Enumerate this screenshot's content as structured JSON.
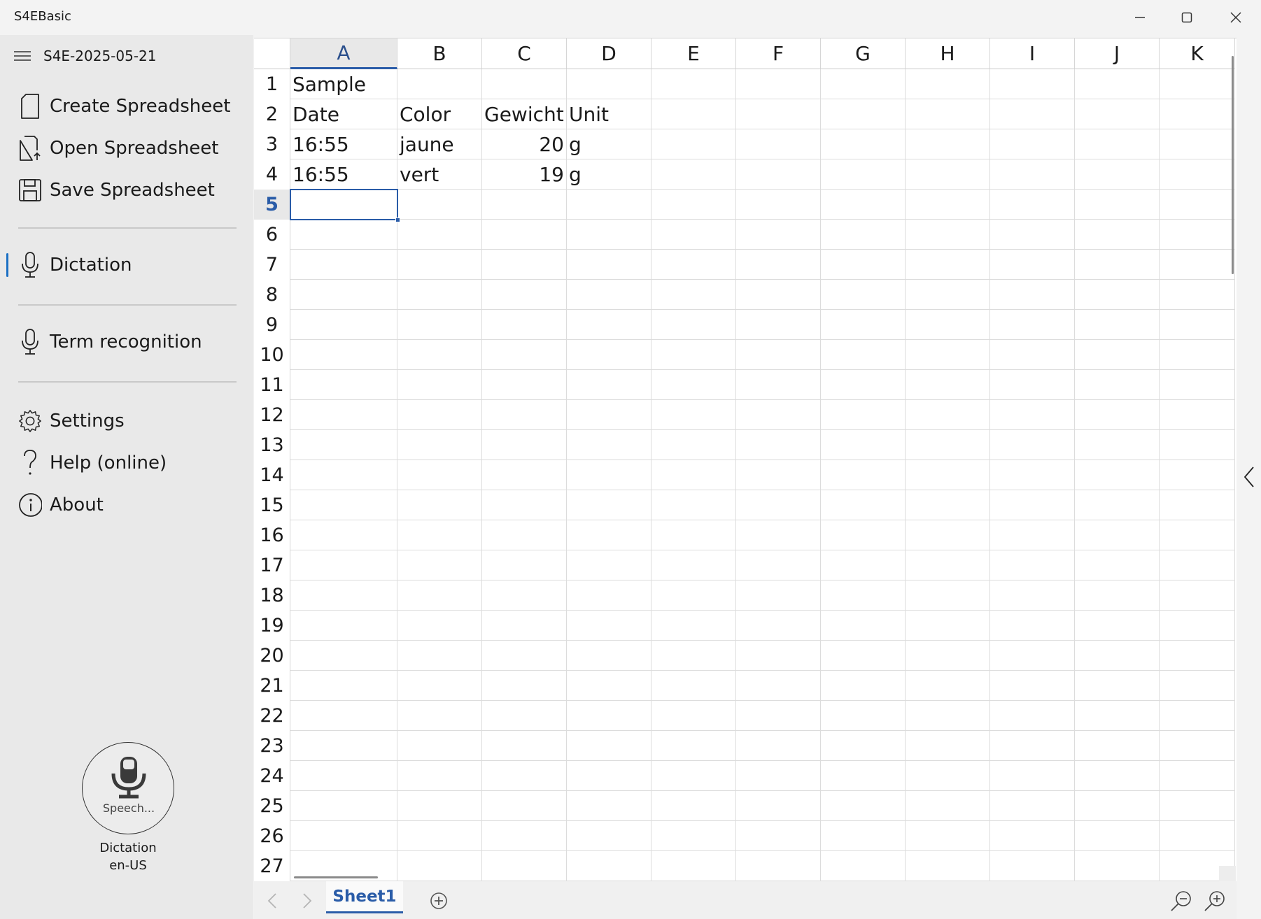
{
  "window": {
    "title": "S4EBasic",
    "controls": [
      "minimize-icon",
      "maximize-icon",
      "close-icon"
    ]
  },
  "sidebar": {
    "document_name": "S4E-2025-05-21",
    "items": [
      {
        "label": "Create Spreadsheet",
        "icon": "new-document-icon"
      },
      {
        "label": "Open Spreadsheet",
        "icon": "open-document-icon"
      },
      {
        "label": "Save Spreadsheet",
        "icon": "save-icon"
      },
      {
        "label": "Dictation",
        "icon": "microphone-icon",
        "active": true
      },
      {
        "label": "Term recognition",
        "icon": "microphone-icon"
      },
      {
        "label": "Settings",
        "icon": "gear-icon"
      },
      {
        "label": "Help (online)",
        "icon": "question-icon"
      },
      {
        "label": "About",
        "icon": "info-icon"
      }
    ],
    "speech_button": {
      "label": "Speech...",
      "icon": "microphone-icon"
    },
    "mode_caption": "Dictation",
    "language_caption": "en-US"
  },
  "spreadsheet": {
    "columns": [
      "A",
      "B",
      "C",
      "D",
      "E",
      "F",
      "G",
      "H",
      "I",
      "J",
      "K"
    ],
    "selected_column": "A",
    "selected_row": 5,
    "rows": [
      "1",
      "2",
      "3",
      "4",
      "5",
      "6",
      "7",
      "8",
      "9",
      "10",
      "11",
      "12",
      "13",
      "14",
      "15",
      "16",
      "17",
      "18",
      "19",
      "20",
      "21",
      "22",
      "23",
      "24",
      "25",
      "26",
      "27"
    ],
    "cells": {
      "A1": "Sample",
      "A2": "Date",
      "B2": "Color",
      "C2": "Gewicht",
      "D2": "Unit",
      "A3": "16:55",
      "B3": "jaune",
      "C3": "20",
      "D3": "g",
      "A4": "16:55",
      "B4": "vert",
      "C4": "19",
      "D4": "g"
    },
    "numeric_cells": [
      "C3",
      "C4"
    ]
  },
  "tabbar": {
    "sheets": [
      "Sheet1"
    ],
    "active_sheet": "Sheet1",
    "accent": "#2a5ca8"
  },
  "colors": {
    "accent": "#2a5ca8",
    "active_indicator": "#1a6fc4",
    "sidebar_bg": "#e9e9e9"
  }
}
